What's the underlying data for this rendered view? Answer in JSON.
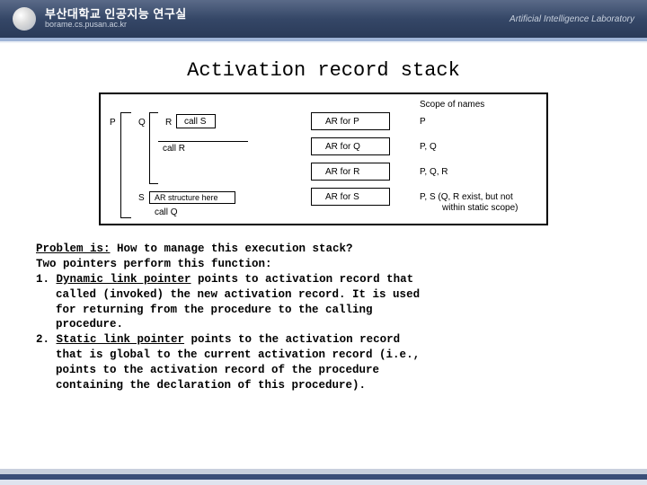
{
  "banner": {
    "title": "부산대학교 인공지능 연구실",
    "subtitle": "borame.cs.pusan.ac.kr",
    "right": "Artificial Intelligence Laboratory"
  },
  "title": "Activation record stack",
  "diagram": {
    "scope_header": "Scope of names",
    "p_label": "P",
    "q_label": "Q",
    "r_label": "R",
    "s_label": "S",
    "call_s": "call S",
    "call_r": "call R",
    "call_q": "call Q",
    "ar_struct": "AR structure here",
    "ar1": "AR for P",
    "ar2": "AR for Q",
    "ar3": "AR for R",
    "ar4": "AR for S",
    "scope1": "P",
    "scope2": "P, Q",
    "scope3": "P, Q, R",
    "scope4": "P, S (Q, R exist, but not",
    "scope4b": "within static scope)"
  },
  "body": {
    "l1a": "Problem is:",
    "l1b": " How to manage this execution stack?",
    "l2": "Two pointers perform this function:",
    "l3a": "1. ",
    "l3b": "Dynamic link pointer",
    "l3c": " points to activation record that",
    "l4": "called (invoked) the new activation record. It is used",
    "l5": "for returning from the procedure to the calling",
    "l6": "procedure.",
    "l7a": "2. ",
    "l7b": "Static link pointer",
    "l7c": " points to the activation record",
    "l8": "that is global to the current activation record (i.e.,",
    "l9": "points to the activation record of the procedure",
    "l10": "containing the declaration of this procedure)."
  }
}
